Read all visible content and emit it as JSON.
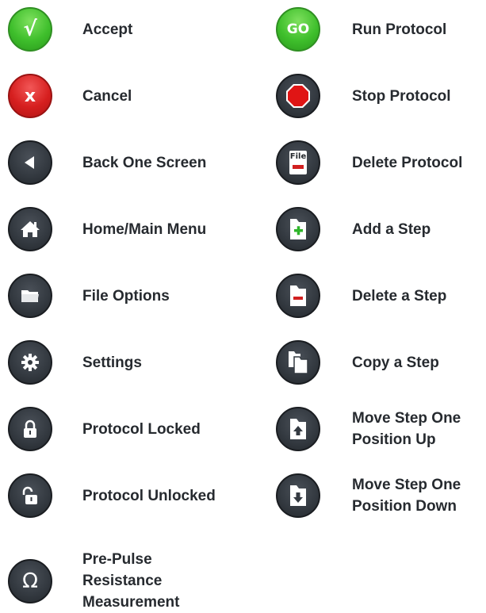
{
  "left_column": [
    {
      "icon": "accept-check-icon",
      "style": "green",
      "label": "Accept"
    },
    {
      "icon": "cancel-x-icon",
      "style": "red",
      "label": "Cancel"
    },
    {
      "icon": "back-arrow-icon",
      "style": "dark",
      "label": "Back One Screen"
    },
    {
      "icon": "home-icon",
      "style": "dark",
      "label": "Home/Main Menu"
    },
    {
      "icon": "folder-icon",
      "style": "dark",
      "label": "File Options"
    },
    {
      "icon": "gear-icon",
      "style": "dark",
      "label": "Settings"
    },
    {
      "icon": "lock-closed-icon",
      "style": "dark",
      "label": "Protocol Locked"
    },
    {
      "icon": "lock-open-icon",
      "style": "dark",
      "label": "Protocol Unlocked"
    },
    {
      "icon": "omega-icon",
      "style": "dark",
      "label": "Pre-Pulse Resistance Measurement"
    }
  ],
  "right_column": [
    {
      "icon": "go-icon",
      "style": "green",
      "label": "Run Protocol",
      "icon_text": "GO"
    },
    {
      "icon": "stop-octagon-icon",
      "style": "dark",
      "label": "Stop Protocol"
    },
    {
      "icon": "delete-file-icon",
      "style": "dark",
      "label": "Delete Protocol",
      "icon_text": "File"
    },
    {
      "icon": "add-step-icon",
      "style": "dark",
      "label": "Add a Step"
    },
    {
      "icon": "delete-step-icon",
      "style": "dark",
      "label": "Delete a Step"
    },
    {
      "icon": "copy-step-icon",
      "style": "dark",
      "label": "Copy a Step"
    },
    {
      "icon": "move-step-up-icon",
      "style": "dark",
      "label": "Move Step One Position Up"
    },
    {
      "icon": "move-step-down-icon",
      "style": "dark",
      "label": "Move Step One Position Down"
    }
  ],
  "icon_glyphs": {
    "accept": "√",
    "cancel": "x",
    "omega": "Ω"
  },
  "colors": {
    "green": "#3fbf2c",
    "red": "#d61f1f",
    "dark": "#343a41",
    "text": "#262a2f",
    "plus": "#2fb52a",
    "minus": "#d11f1f",
    "stop": "#e01515"
  }
}
